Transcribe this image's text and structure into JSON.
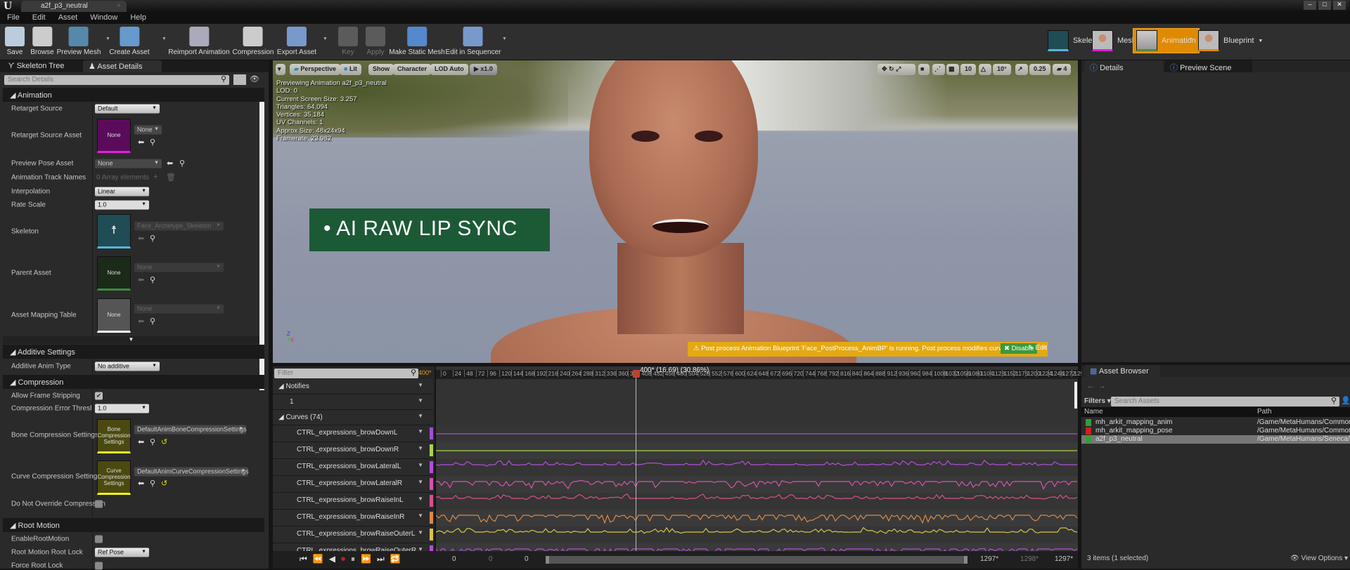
{
  "window": {
    "doc_tab": "a2f_p3_neutral"
  },
  "menu": [
    "File",
    "Edit",
    "Asset",
    "Window",
    "Help"
  ],
  "toolbar": [
    {
      "label": "Save",
      "icon": "save-icon",
      "enabled": true
    },
    {
      "label": "Browse",
      "icon": "browse-icon",
      "enabled": true
    },
    {
      "label": "Preview Mesh",
      "icon": "preview-mesh-icon",
      "enabled": true
    },
    {
      "label": "Create Asset",
      "icon": "create-asset-icon",
      "enabled": true
    },
    {
      "label": "Reimport Animation",
      "icon": "reimport-icon",
      "enabled": true
    },
    {
      "label": "Compression",
      "icon": "compression-icon",
      "enabled": true
    },
    {
      "label": "Export Asset",
      "icon": "export-icon",
      "enabled": true
    },
    {
      "label": "Key",
      "icon": "plus-icon",
      "enabled": false
    },
    {
      "label": "Apply",
      "icon": "check-icon",
      "enabled": false
    },
    {
      "label": "Make Static Mesh",
      "icon": "house-icon",
      "enabled": true
    },
    {
      "label": "Edit in Sequencer",
      "icon": "sequencer-icon",
      "enabled": true
    }
  ],
  "modes": {
    "skeleton": "Skeleton",
    "mesh": "Mesh",
    "animation": "Animation",
    "blueprint": "Blueprint",
    "active_color": "#e08a00"
  },
  "left": {
    "tabs": [
      "Skeleton Tree",
      "Asset Details"
    ],
    "search_placeholder": "Search Details",
    "sections": {
      "animation": "Animation",
      "additive": "Additive Settings",
      "compression": "Compression",
      "root_motion": "Root Motion"
    },
    "labels": {
      "retarget_source": "Retarget Source",
      "retarget_source_asset": "Retarget Source Asset",
      "preview_pose_asset": "Preview Pose Asset",
      "track_names": "Animation Track Names",
      "interpolation": "Interpolation",
      "rate_scale": "Rate Scale",
      "skeleton": "Skeleton",
      "parent_asset": "Parent Asset",
      "asset_mapping": "Asset Mapping Table",
      "additive_type": "Additive Anim Type",
      "allow_frame_stripping": "Allow Frame Stripping",
      "compression_error": "Compression Error Threshold S",
      "bone_compression": "Bone Compression Settings",
      "curve_compression": "Curve Compression Settings",
      "do_not_override": "Do Not Override Compression",
      "enable_root_motion": "EnableRootMotion",
      "root_lock": "Root Motion Root Lock",
      "force_root_lock": "Force Root Lock"
    },
    "values": {
      "retarget_source": "Default",
      "retarget_source_asset": "None",
      "retarget_thumb": "None",
      "preview_pose_asset": "None",
      "track_names": "0 Array elements",
      "interpolation": "Linear",
      "rate_scale": "1.0",
      "skeleton": "Face_Archetype_Skeleton",
      "parent_asset": "None",
      "parent_thumb": "None",
      "asset_mapping": "None",
      "asset_mapping_thumb": "None",
      "additive_type": "No additive",
      "allow_frame_stripping": true,
      "compression_error": "1.0",
      "bone_compression": "DefaultAnimBoneCompressionSettings",
      "bone_thumb": "Bone Compression Settings",
      "curve_compression": "DefaultAnimCurveCompressionSettings",
      "curve_thumb": "Curve Compression Settings",
      "do_not_override": false,
      "enable_root_motion": false,
      "root_lock": "Ref Pose",
      "force_root_lock": false
    }
  },
  "viewport": {
    "buttons": {
      "perspective": "Perspective",
      "lit": "Lit",
      "show": "Show",
      "character": "Character",
      "lod": "LOD Auto",
      "speed": "x1.0"
    },
    "snap": {
      "grid": "10",
      "rotation": "10°",
      "scale": "0.25",
      "camera_speed": "4"
    },
    "stats": [
      "Previewing Animation a2f_p3_neutral",
      "LOD: 0",
      "Current Screen Size: 3.257",
      "Triangles: 64,094",
      "Vertices: 35,184",
      "UV Channels: 1",
      "Approx Size: 48x24x94",
      "Framerate: 23.982"
    ],
    "banner": "• AI RAW LIP SYNC",
    "warning": "Post process Animation Blueprint 'Face_PostProcess_AnimBP' is running. Post process modifies curves.",
    "disable": "Disable",
    "edit": "Edit"
  },
  "timeline": {
    "filter_placeholder": "Filter",
    "current_frame_label": "400*",
    "scrubber_label": "400* (16.69) (30.86%)",
    "current_frame": 400,
    "total_frames": 1297,
    "tick_step": 24,
    "notifies": "Notifies",
    "notify_track": "1",
    "curves_header": "Curves",
    "curves_count": "(74)",
    "curves": [
      {
        "name": "CTRL_expressions_browDownL",
        "color": "#a24fd6",
        "active": false
      },
      {
        "name": "CTRL_expressions_browDownR",
        "color": "#a8d44a",
        "active": false
      },
      {
        "name": "CTRL_expressions_browLateralL",
        "color": "#b24fd6",
        "active": true
      },
      {
        "name": "CTRL_expressions_browLateralR",
        "color": "#d652b0",
        "active": true
      },
      {
        "name": "CTRL_expressions_browRaiseInL",
        "color": "#d6508a",
        "active": true
      },
      {
        "name": "CTRL_expressions_browRaiseInR",
        "color": "#d68a4a",
        "active": true
      },
      {
        "name": "CTRL_expressions_browRaiseOuterL",
        "color": "#d6c24a",
        "active": true
      },
      {
        "name": "CTRL_expressions_browRaiseOuterR",
        "color": "#b24fd6",
        "active": true
      }
    ],
    "range": {
      "start": "0",
      "view_start": "0",
      "work_start": "0",
      "end": "1297*",
      "view_end": "1298*",
      "work_end": "1297*"
    }
  },
  "right": {
    "tabs": [
      "Details",
      "Preview Scene Sett"
    ],
    "asset_browser": {
      "tab": "Asset Browser",
      "filters": "Filters",
      "search_placeholder": "Search Assets",
      "col_name": "Name",
      "col_path": "Path",
      "rows": [
        {
          "name": "mh_arkit_mapping_anim",
          "path": "/Game/MetaHumans/Commor",
          "color": "#3a9a3a",
          "selected": false
        },
        {
          "name": "mh_arkit_mapping_pose",
          "path": "/Game/MetaHumans/Commor",
          "color": "#d02020",
          "selected": false
        },
        {
          "name": "a2f_p3_neutral",
          "path": "/Game/MetaHumans/Seneca/.",
          "color": "#3a9a3a",
          "selected": true
        }
      ],
      "status": "3 items (1 selected)",
      "view_options": "View Options"
    }
  }
}
